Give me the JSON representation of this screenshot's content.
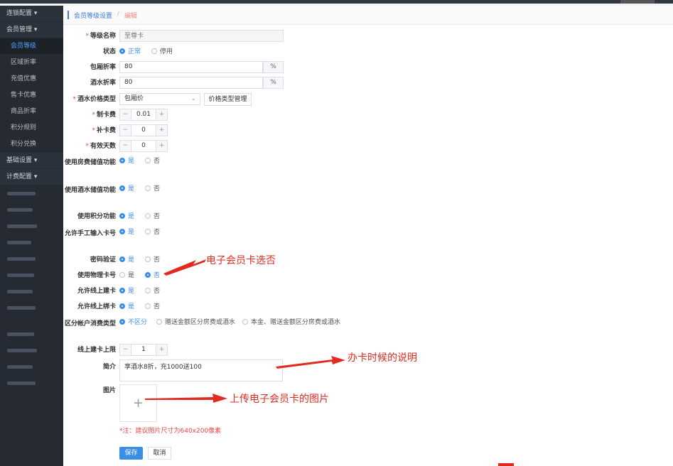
{
  "sidebar": {
    "groups": [
      {
        "label": "连锁配置"
      },
      {
        "label": "会员管理"
      },
      {
        "label": "基础设置"
      },
      {
        "label": "计费配置"
      }
    ],
    "member_items": [
      "会员等级",
      "区域折率",
      "充值优惠",
      "售卡优惠",
      "商品折率",
      "积分规则",
      "积分兑换"
    ]
  },
  "breadcrumb": {
    "parent": "会员等级设置",
    "separator": "/",
    "current": "编辑"
  },
  "form": {
    "level_name": {
      "label": "等级名称",
      "placeholder": "至尊卡"
    },
    "status": {
      "label": "状态",
      "options": [
        "正常",
        "停用"
      ],
      "selected": "正常"
    },
    "room_rate": {
      "label": "包厢折率",
      "value": "80",
      "unit": "%"
    },
    "drink_rate": {
      "label": "酒水折率",
      "value": "80",
      "unit": "%"
    },
    "price_type": {
      "label": "酒水价格类型",
      "value": "包厢价",
      "manage_button": "价格类型管理"
    },
    "card_fee": {
      "label": "制卡费",
      "value": "0.01"
    },
    "reissue_fee": {
      "label": "补卡费",
      "value": "0"
    },
    "valid_days": {
      "label": "有效天数",
      "value": "0"
    },
    "room_stored_value": {
      "label": "使用房费储值功能",
      "options": [
        "是",
        "否"
      ],
      "selected": "是"
    },
    "drink_stored_value": {
      "label": "使用酒水储值功能",
      "options": [
        "是",
        "否"
      ],
      "selected": "是"
    },
    "points": {
      "label": "使用积分功能",
      "options": [
        "是",
        "否"
      ],
      "selected": "是"
    },
    "manual_card": {
      "label": "允许手工输入卡号",
      "options": [
        "是",
        "否"
      ],
      "selected": "是"
    },
    "password": {
      "label": "密码验证",
      "options": [
        "是",
        "否"
      ],
      "selected": "是"
    },
    "physical_card": {
      "label": "使用物理卡号",
      "options": [
        "是",
        "否"
      ],
      "selected": "否"
    },
    "online_create": {
      "label": "允许线上建卡",
      "options": [
        "是",
        "否"
      ],
      "selected": "是"
    },
    "online_bind": {
      "label": "允许线上绑卡",
      "options": [
        "是",
        "否"
      ],
      "selected": "是"
    },
    "account_type": {
      "label": "区分帐户消费类型",
      "options": [
        "不区分",
        "赠送金额区分房费或酒水",
        "本金、赠送金额区分房费或酒水"
      ],
      "selected": "不区分"
    },
    "online_limit": {
      "label": "线上建卡上限",
      "value": "1"
    },
    "intro": {
      "label": "简介",
      "value": "享酒水8折，充1000送100"
    },
    "image": {
      "label": "图片",
      "upload_symbol": "+",
      "note": "*注：建议图片尺寸为640x200像素"
    },
    "actions": {
      "save": "保存",
      "cancel": "取消"
    },
    "stepper_minus": "−",
    "stepper_plus": "+"
  },
  "annotations": {
    "a1": "电子会员卡选否",
    "a2": "办卡时候的说明",
    "a3": "上传电子会员卡的图片"
  },
  "colors": {
    "accent": "#3a8ee6",
    "annotation": "#e02b20",
    "sidebar": "#252a33"
  }
}
